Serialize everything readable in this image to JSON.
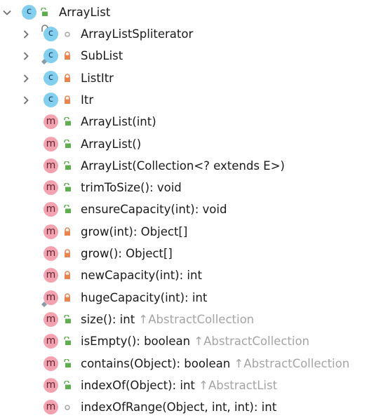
{
  "root": {
    "label": "ArrayList",
    "kind": "C",
    "access": "public",
    "expanded": true
  },
  "items": [
    {
      "kind": "C",
      "access": "package",
      "label": "ArrayListSpliterator",
      "expandable": true,
      "badge": "static"
    },
    {
      "kind": "C",
      "access": "private",
      "label": "SubList",
      "expandable": true,
      "badge": "overlay"
    },
    {
      "kind": "C",
      "access": "private",
      "label": "ListItr",
      "expandable": true
    },
    {
      "kind": "C",
      "access": "private",
      "label": "Itr",
      "expandable": true
    },
    {
      "kind": "m",
      "access": "public",
      "label": "ArrayList(int)"
    },
    {
      "kind": "m",
      "access": "public",
      "label": "ArrayList()"
    },
    {
      "kind": "m",
      "access": "public",
      "label": "ArrayList(Collection<? extends E>)"
    },
    {
      "kind": "m",
      "access": "public",
      "label": "trimToSize(): void"
    },
    {
      "kind": "m",
      "access": "public",
      "label": "ensureCapacity(int): void"
    },
    {
      "kind": "m",
      "access": "private",
      "label": "grow(int): Object[]"
    },
    {
      "kind": "m",
      "access": "private",
      "label": "grow(): Object[]"
    },
    {
      "kind": "m",
      "access": "private",
      "label": "newCapacity(int): int"
    },
    {
      "kind": "m",
      "access": "private",
      "label": "hugeCapacity(int): int",
      "badge": "overlay"
    },
    {
      "kind": "m",
      "access": "public",
      "label": "size(): int",
      "inherited": "↑AbstractCollection"
    },
    {
      "kind": "m",
      "access": "public",
      "label": "isEmpty(): boolean",
      "inherited": "↑AbstractCollection"
    },
    {
      "kind": "m",
      "access": "public",
      "label": "contains(Object): boolean",
      "inherited": "↑AbstractCollection"
    },
    {
      "kind": "m",
      "access": "public",
      "label": "indexOf(Object): int",
      "inherited": "↑AbstractList"
    },
    {
      "kind": "m",
      "access": "package",
      "label": "indexOfRange(Object, int, int): int"
    }
  ],
  "colors": {
    "class_icon": "#82cff0",
    "method_icon": "#f3a2b0",
    "public_lock": "#5fae4e",
    "private_lock": "#e8844f",
    "package_circle": "#9a9a9a",
    "inherited_text": "#a4a4a4"
  }
}
